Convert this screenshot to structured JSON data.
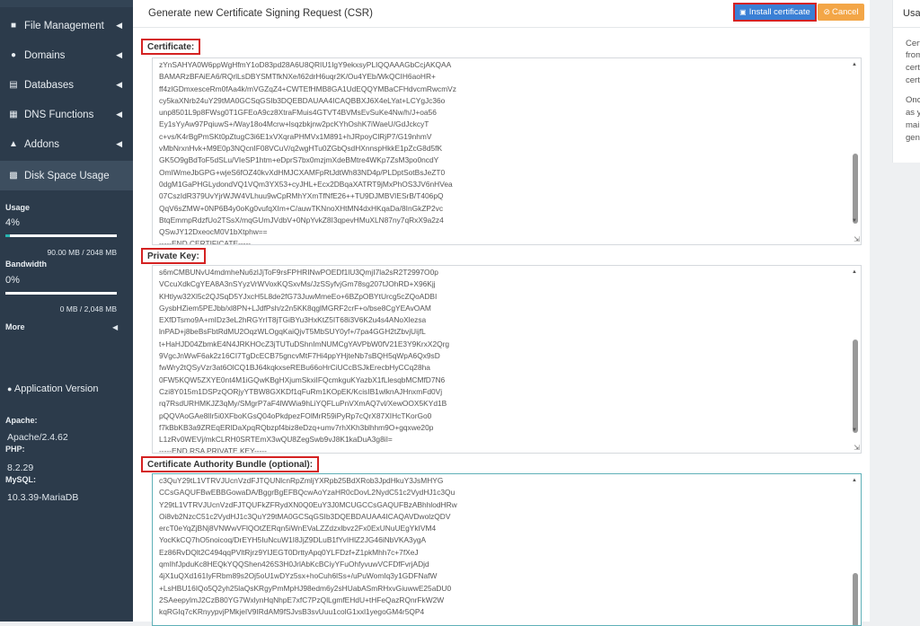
{
  "sidebar": {
    "items": [
      {
        "label": "File Management",
        "icon": "file-icon"
      },
      {
        "label": "Domains",
        "icon": "globe-icon"
      },
      {
        "label": "Databases",
        "icon": "database-icon"
      },
      {
        "label": "DNS Functions",
        "icon": "dns-icon"
      },
      {
        "label": "Addons",
        "icon": "bank-icon"
      },
      {
        "label": "Disk Space Usage",
        "icon": "disk-icon"
      }
    ],
    "usage_label": "Usage",
    "usage_percent": "4%",
    "usage_fraction": 0.04,
    "usage_text": "90.00 MB / 2048 MB",
    "bandwidth_label": "Bandwidth",
    "bandwidth_percent": "0%",
    "bandwidth_fraction": 0.0,
    "bandwidth_text": "0 MB / 2,048 MB",
    "more_label": "More",
    "app_version_label": "Application Version",
    "apache_label": "Apache:",
    "apache_value": "Apache/2.4.62",
    "php_label": "PHP:",
    "php_value": "8.2.29",
    "mysql_label": "MySQL:",
    "mysql_value": "10.3.39-MariaDB"
  },
  "panel": {
    "title": "Generate new Certificate Signing Request (CSR)",
    "install_button": "Install certificate",
    "cancel_button": "Cancel",
    "certificate_label": "Certificate:",
    "private_key_label": "Private Key:",
    "ca_bundle_label": "Certificate Authority Bundle (optional):",
    "certificate_lines": [
      "zYnSAHYA0W6ppWgHfmY1oD83pd28A6U8QRIU1IgY9ekxsyPLIQQAAAGbCcjAKQAA",
      "BAMARzBFAiEA6/RQrlLsDBYSMTfkNXe/l62drH6uqr2K/Ou4YEb/WkQCIH6aoHR+",
      "ff4zlGDmxesceRm0fAa4k/mVGZqZ4+CWTEfHMB8GA1UdEQQYMBaCFHdvcmRwcmVz",
      "cy5kaXNrb24uY29tMA0GCSqGSIb3DQEBDAUAA4ICAQBBXJ6X4eLYat+LCYgJc36o",
      "unp8501L9p8FWsg0T1GFEoA9cz8XtraFMuis4GTVT4BVMsEvSuKe4Nw/h/J+oa56",
      "Ey1sYyAw97PqiuwS+/Way18o4Mcrw+lsqzbkjnw2pcKYhOshK7iWaeU/GdJckcyT",
      "c+vs/K4rBgPmSKt0pZtugC3i6E1xVXqraPHMVx1M891+hJRpoyClRjP7/G19nhmV",
      "vMbNrxnHvk+M9E0p3NQcnIF08VCuV/q2wgHTu0ZGbQsdHXnnspHkkE1pZcG8d5fK",
      "GK5O9gBdToF5dSLu/VIeSP1htm+eDprS7bx0mzjmXdeBMtre4WKp7ZsM3po0ncdY",
      "OmIWmeJbGPG+wjeS6fOZ40kvXdHMJCXAMFpRtJdtWh83ND4p/PLDptSotBsJeZT0",
      "0dgM1GaPHGLydondVQ1VQm3YX53+cyJHL+Ecx2DBqaXATRT9jMxPhOS3JV6nHVea",
      "07CszIdR379UvYjrWJW4VLhuu9wCpRMhYXmTfNfE26++TU9DJMBVIESrB/T406pQ",
      "QqV6sZMW+0NP6B4y0oKg0vufqXIm+C/auwTKNnoXHtMN4dxHKqaDa/8InGkZP2vc",
      "BtqEmmpRdzfUo2TSsX/mqGUmJVdbV+0NpYvkZ8I3qpevHMuXLN87ny7qRxX9a2z4",
      "QSwJY12DxeocM0V1bXtphw==",
      "-----END CERTIFICATE-----"
    ],
    "private_key_lines": [
      "s6mCMBUNvU4mdmheNu6zlJjToF9rsFPHRINwPOEDf1lU3QmjI7la2sR2T2997O0p",
      "VCcuXdkCgYEA8A3nSYyzVrWVoxKQSxvMs/JzSSyfvjGm78sg207tJOhRD+X96Kjj",
      "KHtlyw32Xl5c2QJSqD5YJxcH5L8de2fG73JuwMmeEo+6BZpOBYtUrcg5cZQoADBI",
      "GysbHZiem5PEJbb/xl8PN+LJdfPsh/z2n5KK8qglMGRF2crF+o/bse8CgYEAvOAM",
      "EXfDTsmo9A+mIDz3eL2hRGYrIT8jTGiBYu3HxKtZ5IT68i3V6K2u4s4ANoXlezsa",
      "lnPAD+j8beBsFbtRdMU2OqzWLOgqKaiQjvT5MbSUY0yf+/7pa4GGH2tZbvjUijfL",
      "t+HaHJD04ZbmkE4N4JRKHOcZ3jTUTuDShnImNUMCgYAVPbW0fV21E3Y9KrxX2Qrg",
      "9VgcJnWwF6ak2z16CI7TgDcECB75gncvMtF7Hi4ppYHjteNb7sBQH5qWpA6Qx9sD",
      "fwWry2tQSyVzr3at6OlCQ1BJ64kqkxseREBu66oHrCiUCcBSJkErecbHyCCq28ha",
      "0FW5KQW5ZXYE0nt4M1iGQwKBgHXjumSkxiIFQcmkguKYazbX1fLlesqbMCMfD7N6",
      "Czi8Y015m1DSPzQORjyYTBW8GXKDf1qFuRm1KOpEK/KcisIB1wlknAJHnxmFd0Vj",
      "rq7RsdURHMKJZ3qMy/SMgrP7aF4lWWia9hLiYQFLuPnVXmAQ7vl/XewOOX5KYd1B",
      "pQQVAoGAe8lIr5i0XFboKGsQ04oPkdpezFOlMrR59iPyRp7cQrX87XIHcTKorGo0",
      "f7kBbKB3a9ZREqERlDaXpqRQbzpf4biz8eDzq+umv7rhXKh3blhhm9O+gqxwe20p",
      "L1zRv0WEVj/mkCLRH0SRTEmX3wQU8ZegSwb9vJ8K1kaDuA3g8iI=",
      "-----END RSA PRIVATE KEY-----"
    ],
    "ca_bundle_lines": [
      "c3QuY29tL1VTRVJUcnVzdFJTQUNlcnRpZmljYXRpb25BdXRob3JpdHkuY3JsMHYG",
      "CCsGAQUFBwEBBGowaDA/BggrBgEFBQcwAoYzaHR0cDovL2NydC51c2VydHJ1c3Qu",
      "Y29tL1VTRVJUcnVzdFJTQUFkZFRydXN0Q0EuY3J0MCUGCCsGAQUFBzABhhlodHRw",
      "Oi8vb2NzcC51c2VydHJ1c3QuY29tMA0GCSqGSIb3DQEBDAUAA4ICAQAVDwolzQDV",
      "ercT0eYqZjBNj8VNWwVFlQOtZERqn5iWnEVaLZZdzxlbvz2Fx0ExUNuUEgYkIVM4",
      "YocKkCQ7hO5noicoq/DrEYH5IuNcuW1I8JjZ9DLuB1fYvIHlZ2JG46iNbVKA3ygA",
      "Ez86RvDQlt2C494qqPVltRjrz9YlJEGT0DrttyApq0YLFDzf+Z1pkMhh7c+7fXeJ",
      "qmIhfJpduKc8HEQkYQQShen426S3H0JrlAbKcBCiyYFuOhfyvuwVCFDfFvrjADjd",
      "4jX1uQXd161IyFRbm89s2Oj5oU1wDYz5sx+hoCuh6lSs+/uPuWomIq3y1GDFNafW",
      "+LsHBU16IQo5Q2yh25laQsKRgyPmMpHJ98edm6y2sHUabASmRHxvGiuwwE25aDU0",
      "2SAeepylmJ2CzB80YG7WxlynHqNhpE7xfC7PzQlLgmfEHdU+tHFeQazRQnrFkW2W",
      "kqRGIq7cKRnyypvjPMkjeIV9IRdAM9fSJvsB3svUuu1colG1xxl1yegoGM4r5QP4"
    ]
  },
  "right_panel": {
    "title": "Usag",
    "lines": [
      "Cert",
      "from",
      "cert",
      "cert",
      "Once",
      "as y",
      "mai",
      "gen"
    ]
  }
}
